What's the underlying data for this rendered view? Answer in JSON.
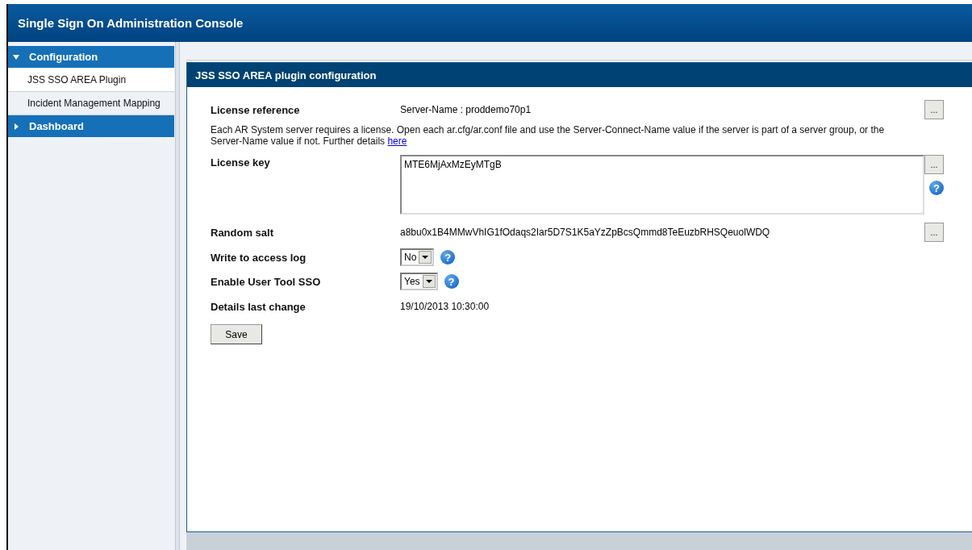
{
  "window": {
    "title": "Single Sign On Administration Console"
  },
  "sidebar": {
    "items": [
      {
        "kind": "section",
        "label": "Configuration",
        "expanded": true,
        "children": [
          {
            "label": "JSS SSO AREA Plugin",
            "selected": true
          },
          {
            "label": "Incident Management Mapping",
            "selected": false
          }
        ]
      },
      {
        "kind": "section",
        "label": "Dashboard",
        "expanded": false
      }
    ]
  },
  "panel": {
    "title": "JSS SSO AREA plugin configuration",
    "fields": [
      {
        "kind": "text",
        "label": "License reference",
        "value": "Server-Name : proddemo70p1",
        "browse": "..."
      },
      {
        "kind": "note",
        "text": "Each AR System server requires a license. Open each ar.cfg/ar.conf file and use the Server-Connect-Name value if the server is part of a server group, or the Server-Name value if not. Further details ",
        "link": "here"
      },
      {
        "kind": "textarea",
        "label": "License key",
        "value": "MTE6MjAxMzEyMTgB",
        "browse": "...",
        "help": "?"
      },
      {
        "kind": "text",
        "label": "Random salt",
        "value": "a8bu0x1B4MMwVhIG1fOdaqs2Iar5D7S1K5aYzZpBcsQmmd8TeEuzbRHSQeuolWDQ",
        "browse": "..."
      },
      {
        "kind": "select",
        "label": "Write to access log",
        "value": "No",
        "help": "?"
      },
      {
        "kind": "select",
        "label": "Enable User Tool SSO",
        "value": "Yes",
        "help": "?"
      },
      {
        "kind": "text",
        "label": "Details last change",
        "value": "19/10/2013 10:30:00"
      }
    ],
    "save": "Save"
  }
}
